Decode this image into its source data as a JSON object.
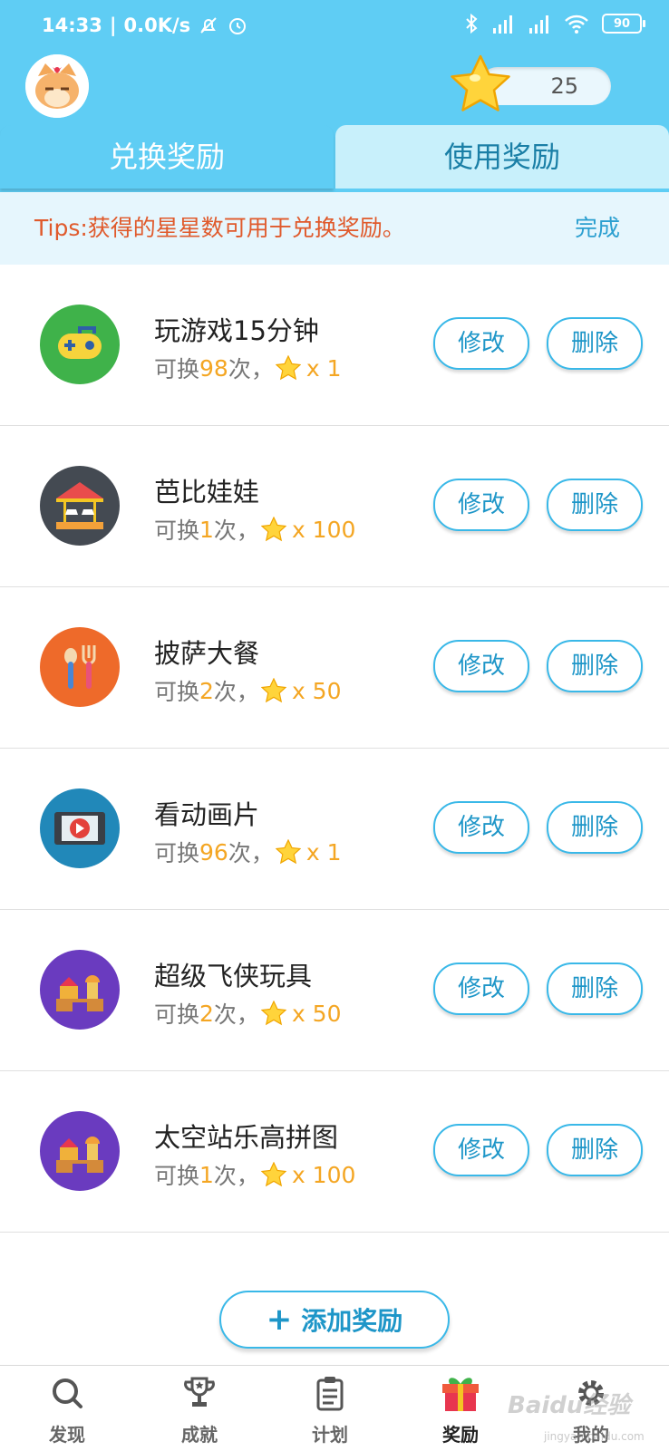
{
  "status_bar": {
    "time": "14:33",
    "speed": "0.0K/s",
    "battery": "90"
  },
  "header": {
    "star_count": "25"
  },
  "tabs": [
    {
      "label": "兑换奖励",
      "active": true
    },
    {
      "label": "使用奖励",
      "active": false
    }
  ],
  "tips": {
    "text": "Tips:获得的星星数可用于兑换奖励。",
    "done_label": "完成"
  },
  "rewards": [
    {
      "title": "玩游戏15分钟",
      "prefix": "可换",
      "count": "98",
      "suffix": "次，",
      "cost": "x 1",
      "icon": "gamepad-icon"
    },
    {
      "title": "芭比娃娃",
      "prefix": "可换",
      "count": "1",
      "suffix": "次，",
      "cost": "x 100",
      "icon": "carousel-icon"
    },
    {
      "title": "披萨大餐",
      "prefix": "可换",
      "count": "2",
      "suffix": "次，",
      "cost": "x 50",
      "icon": "cutlery-icon"
    },
    {
      "title": "看动画片",
      "prefix": "可换",
      "count": "96",
      "suffix": "次，",
      "cost": "x 1",
      "icon": "video-icon"
    },
    {
      "title": "超级飞侠玩具",
      "prefix": "可换",
      "count": "2",
      "suffix": "次，",
      "cost": "x 50",
      "icon": "toy-blocks-icon"
    },
    {
      "title": "太空站乐高拼图",
      "prefix": "可换",
      "count": "1",
      "suffix": "次，",
      "cost": "x 100",
      "icon": "toy-blocks-icon"
    }
  ],
  "row_buttons": {
    "edit_label": "修改",
    "delete_label": "删除"
  },
  "add_button": {
    "plus": "+",
    "label": "添加奖励"
  },
  "bottom_nav": [
    {
      "label": "发现",
      "icon": "search-icon"
    },
    {
      "label": "成就",
      "icon": "trophy-icon"
    },
    {
      "label": "计划",
      "icon": "clipboard-icon"
    },
    {
      "label": "奖励",
      "icon": "gift-icon",
      "active": true
    },
    {
      "label": "我的",
      "icon": "gear-icon"
    }
  ],
  "watermark": {
    "text": "Baidu经验",
    "sub": "jingyan.baidu.com"
  },
  "colors": {
    "header_bg": "#5fcdf4",
    "accent": "#39b8e8",
    "tips_text": "#e05a2c",
    "star": "#f4a623"
  }
}
